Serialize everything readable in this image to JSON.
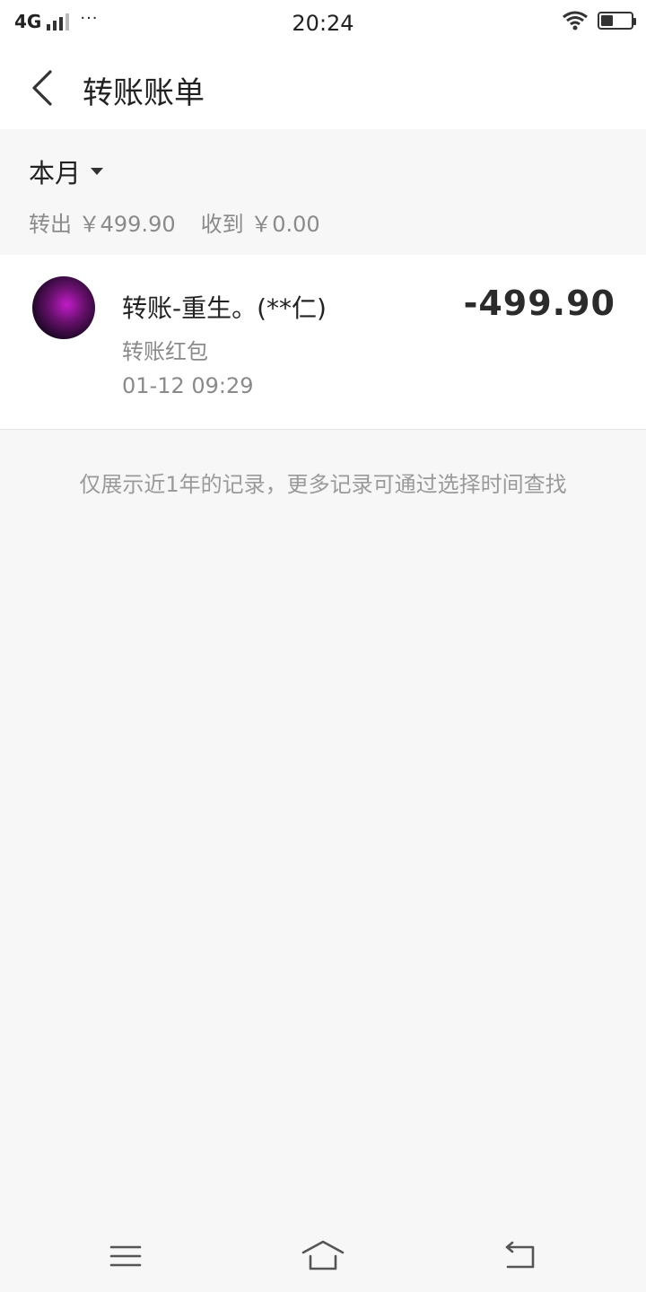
{
  "status_bar": {
    "network": "4G",
    "dots": "···",
    "time": "20:24",
    "icons": [
      "signal-icon",
      "wifi-icon",
      "battery-icon"
    ]
  },
  "nav": {
    "title": "转账账单"
  },
  "filter": {
    "month": "本月"
  },
  "summary": {
    "out_label": "转出 ￥499.90",
    "in_label": "收到 ￥0.00"
  },
  "records": [
    {
      "title": "转账-重生。(**仁)",
      "amount": "-499.90",
      "type": "转账红包",
      "time": "01-12  09:29"
    }
  ],
  "footer_note": "仅展示近1年的记录，更多记录可通过选择时间查找",
  "colors": {
    "background": "#f7f7f7",
    "card": "#ffffff",
    "primary_text": "#222222",
    "secondary_text": "#8a8a8a"
  }
}
